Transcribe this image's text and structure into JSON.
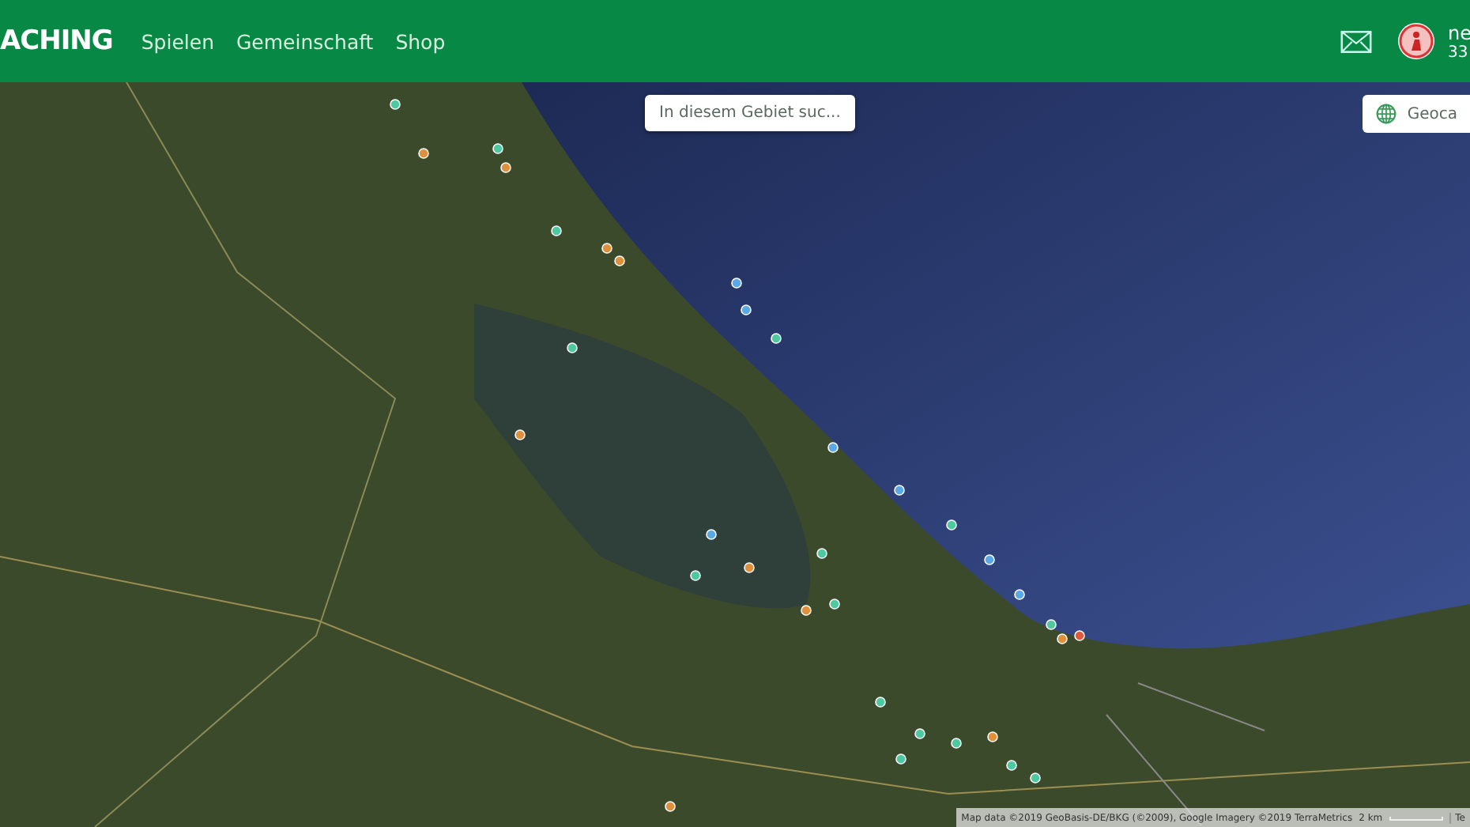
{
  "header": {
    "logo": "ACHING",
    "nav": [
      {
        "label": "Spielen"
      },
      {
        "label": "Gemeinschaft"
      },
      {
        "label": "Shop"
      }
    ],
    "user": {
      "name": "ne",
      "points": "33"
    }
  },
  "map": {
    "search_area_button": "In diesem Gebiet suc...",
    "layer_button": "Geoca",
    "attribution": "Map data ©2019 GeoBasis-DE/BKG (©2009), Google Imagery ©2019 TerraMetrics",
    "scale": "2 km",
    "terms": "Te"
  }
}
